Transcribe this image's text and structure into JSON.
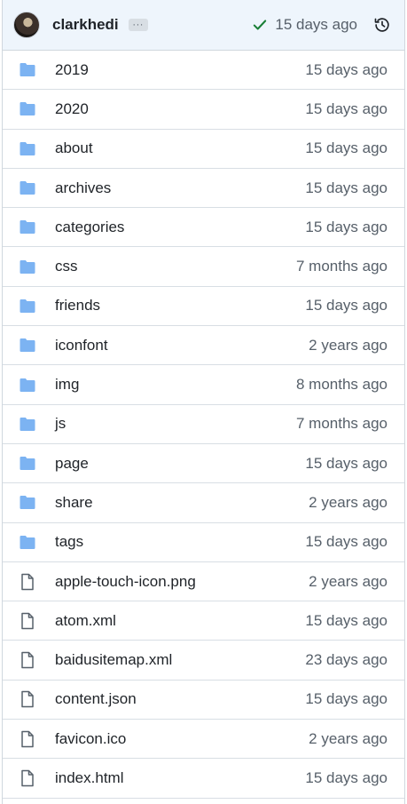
{
  "commit": {
    "author": "clarkhedi",
    "ellipsis": "···",
    "status_icon": "check-icon",
    "time": "15 days ago",
    "history_icon": "history-icon"
  },
  "colors": {
    "header_bg": "#eef5fc",
    "folder": "#7cb3f2",
    "check": "#1a7f37",
    "muted": "#57606a"
  },
  "files": [
    {
      "name": "2019",
      "type": "folder",
      "time": "15 days ago"
    },
    {
      "name": "2020",
      "type": "folder",
      "time": "15 days ago"
    },
    {
      "name": "about",
      "type": "folder",
      "time": "15 days ago"
    },
    {
      "name": "archives",
      "type": "folder",
      "time": "15 days ago"
    },
    {
      "name": "categories",
      "type": "folder",
      "time": "15 days ago"
    },
    {
      "name": "css",
      "type": "folder",
      "time": "7 months ago"
    },
    {
      "name": "friends",
      "type": "folder",
      "time": "15 days ago"
    },
    {
      "name": "iconfont",
      "type": "folder",
      "time": "2 years ago"
    },
    {
      "name": "img",
      "type": "folder",
      "time": "8 months ago"
    },
    {
      "name": "js",
      "type": "folder",
      "time": "7 months ago"
    },
    {
      "name": "page",
      "type": "folder",
      "time": "15 days ago"
    },
    {
      "name": "share",
      "type": "folder",
      "time": "2 years ago"
    },
    {
      "name": "tags",
      "type": "folder",
      "time": "15 days ago"
    },
    {
      "name": "apple-touch-icon.png",
      "type": "file",
      "time": "2 years ago"
    },
    {
      "name": "atom.xml",
      "type": "file",
      "time": "15 days ago"
    },
    {
      "name": "baidusitemap.xml",
      "type": "file",
      "time": "23 days ago"
    },
    {
      "name": "content.json",
      "type": "file",
      "time": "15 days ago"
    },
    {
      "name": "favicon.ico",
      "type": "file",
      "time": "2 years ago"
    },
    {
      "name": "index.html",
      "type": "file",
      "time": "15 days ago"
    }
  ]
}
